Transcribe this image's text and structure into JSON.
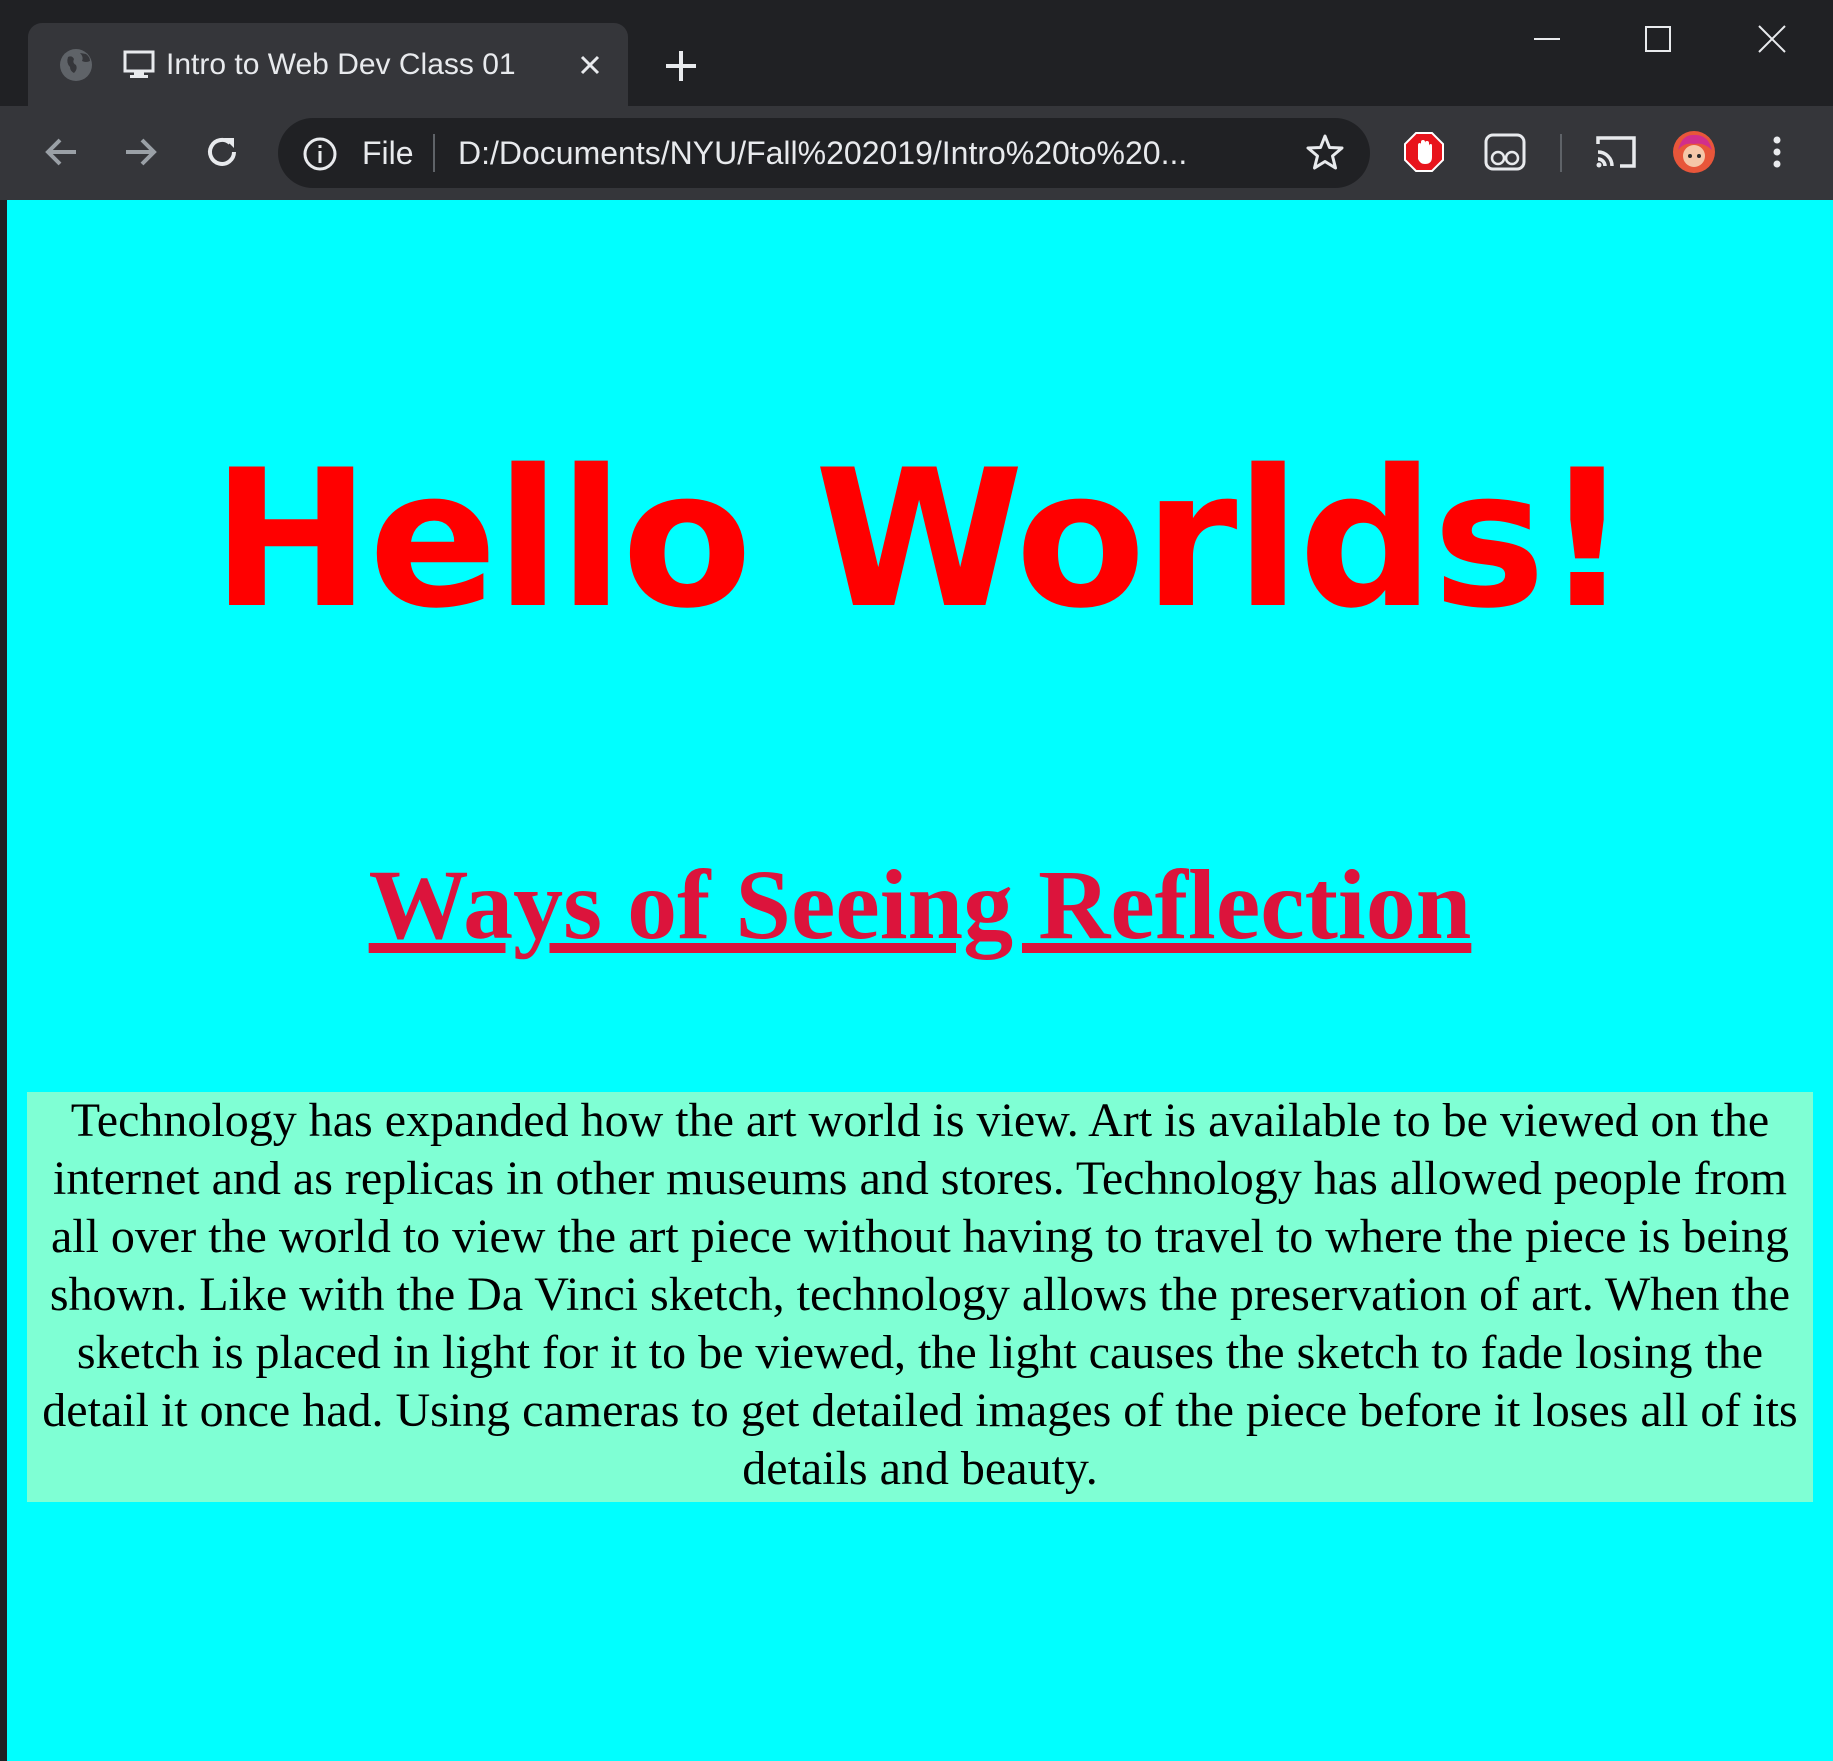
{
  "browser": {
    "tab": {
      "title": "Intro to Web Dev Class 01",
      "favicon": "globe-icon",
      "page_icon": "monitor-icon"
    },
    "omnibox": {
      "scheme": "File",
      "url": "D:/Documents/NYU/Fall%202019/Intro%20to%20..."
    },
    "extensions": [
      "adblock-icon",
      "reader-icon",
      "cast-icon",
      "profile-avatar"
    ],
    "colors": {
      "tabstrip": "#202124",
      "toolbar": "#35363a",
      "text": "#e8eaed"
    }
  },
  "page": {
    "background": "#00ffff",
    "heading": "Hello Worlds!",
    "heading_color": "#ff0000",
    "subheading": "Ways of Seeing Reflection",
    "subheading_color": "#dc143c",
    "paragraph": "Technology has expanded how the art world is view. Art is available to be viewed on the internet and as replicas in other museums and stores. Technology has allowed people from all over the world to view the art piece without having to travel to where the piece is being shown. Like with the Da Vinci sketch, technology allows the preservation of art. When the sketch is placed in light for it to be viewed, the light causes the sketch to fade losing the detail it once had. Using cameras to get detailed images of the piece before it loses all of its details and beauty.",
    "paragraph_background": "#7fffd4"
  }
}
